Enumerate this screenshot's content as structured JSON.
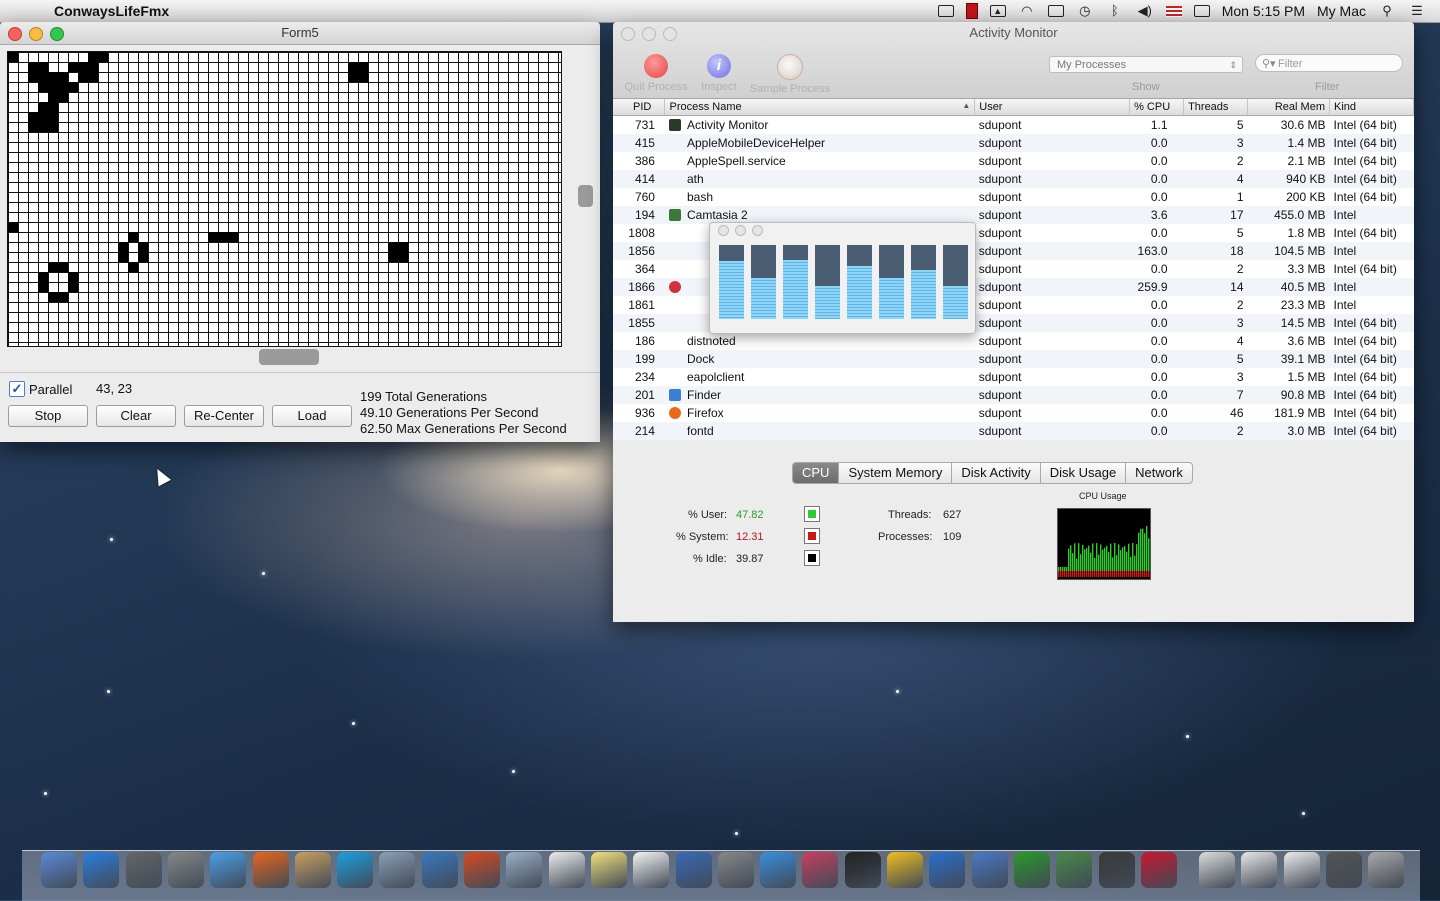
{
  "menubar": {
    "app_name": "ConwaysLifeFmx",
    "clock": "Mon 5:15 PM",
    "user": "My Mac"
  },
  "form5": {
    "title": "Form5",
    "parallel_label": "Parallel",
    "parallel_checked": true,
    "coords": "43, 23",
    "buttons": {
      "stop": "Stop",
      "clear": "Clear",
      "recenter": "Re-Center",
      "load": "Load"
    },
    "stats": [
      "199 Total Generations",
      "49.10 Generations Per Second",
      "62.50 Max Generations Per Second"
    ]
  },
  "activity_monitor": {
    "title": "Activity Monitor",
    "toolbar": {
      "quit": "Quit Process",
      "inspect": "Inspect",
      "sample": "Sample Process",
      "show_value": "My Processes",
      "show_label": "Show",
      "filter_placeholder": "Filter",
      "filter_label": "Filter"
    },
    "columns": [
      "PID",
      "Process Name",
      "User",
      "% CPU",
      "Threads",
      "Real Mem",
      "Kind"
    ],
    "rows": [
      [
        "731",
        "Activity Monitor",
        "sdupont",
        "1.1",
        "5",
        "30.6 MB",
        "Intel (64 bit)"
      ],
      [
        "415",
        "AppleMobileDeviceHelper",
        "sdupont",
        "0.0",
        "3",
        "1.4 MB",
        "Intel (64 bit)"
      ],
      [
        "386",
        "AppleSpell.service",
        "sdupont",
        "0.0",
        "2",
        "2.1 MB",
        "Intel (64 bit)"
      ],
      [
        "414",
        "ath",
        "sdupont",
        "0.0",
        "4",
        "940 KB",
        "Intel (64 bit)"
      ],
      [
        "760",
        "bash",
        "sdupont",
        "0.0",
        "1",
        "200 KB",
        "Intel (64 bit)"
      ],
      [
        "194",
        "Camtasia 2",
        "sdupont",
        "3.6",
        "17",
        "455.0 MB",
        "Intel"
      ],
      [
        "1808",
        "",
        "sdupont",
        "0.0",
        "5",
        "1.8 MB",
        "Intel (64 bit)"
      ],
      [
        "1856",
        "",
        "sdupont",
        "163.0",
        "18",
        "104.5 MB",
        "Intel"
      ],
      [
        "364",
        "",
        "sdupont",
        "0.0",
        "2",
        "3.3 MB",
        "Intel (64 bit)"
      ],
      [
        "1866",
        "",
        "sdupont",
        "259.9",
        "14",
        "40.5 MB",
        "Intel"
      ],
      [
        "1861",
        "",
        "sdupont",
        "0.0",
        "2",
        "23.3 MB",
        "Intel"
      ],
      [
        "1855",
        "",
        "sdupont",
        "0.0",
        "3",
        "14.5 MB",
        "Intel (64 bit)"
      ],
      [
        "186",
        "distnoted",
        "sdupont",
        "0.0",
        "4",
        "3.6 MB",
        "Intel (64 bit)"
      ],
      [
        "199",
        "Dock",
        "sdupont",
        "0.0",
        "5",
        "39.1 MB",
        "Intel (64 bit)"
      ],
      [
        "234",
        "eapolclient",
        "sdupont",
        "0.0",
        "3",
        "1.5 MB",
        "Intel (64 bit)"
      ],
      [
        "201",
        "Finder",
        "sdupont",
        "0.0",
        "7",
        "90.8 MB",
        "Intel (64 bit)"
      ],
      [
        "936",
        "Firefox",
        "sdupont",
        "0.0",
        "46",
        "181.9 MB",
        "Intel (64 bit)"
      ],
      [
        "214",
        "fontd",
        "sdupont",
        "0.0",
        "2",
        "3.0 MB",
        "Intel (64 bit)"
      ]
    ],
    "tabs": [
      "CPU",
      "System Memory",
      "Disk Activity",
      "Disk Usage",
      "Network"
    ],
    "selected_tab": "CPU",
    "cpu": {
      "user_label": "% User:",
      "user_value": "47.82",
      "user_color": "#2ecc2e",
      "system_label": "% System:",
      "system_value": "12.31",
      "system_color": "#d01515",
      "idle_label": "% Idle:",
      "idle_value": "39.87",
      "idle_color": "#000000",
      "threads_label": "Threads:",
      "threads_value": "627",
      "processes_label": "Processes:",
      "processes_value": "109",
      "graph_title": "CPU Usage"
    },
    "core_meter_levels": [
      0.78,
      0.55,
      0.8,
      0.45,
      0.72,
      0.55,
      0.66,
      0.45
    ]
  }
}
